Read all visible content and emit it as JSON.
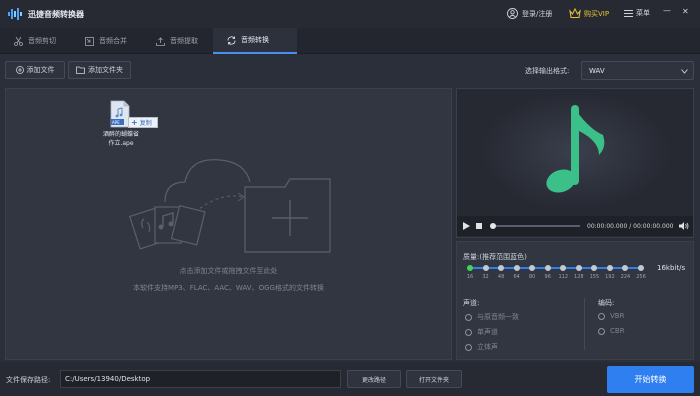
{
  "titlebar": {
    "app_title": "迅捷音频转换器",
    "login": "登录/注册",
    "vip": "购买VIP",
    "menu": "菜单",
    "minimize": "—",
    "close": "✕"
  },
  "tabs": [
    {
      "label": "音频剪切",
      "icon": "scissors-icon"
    },
    {
      "label": "音频合并",
      "icon": "merge-icon"
    },
    {
      "label": "音频提取",
      "icon": "upload-icon"
    },
    {
      "label": "音频转换",
      "icon": "refresh-icon"
    }
  ],
  "toolbar": {
    "add_file": "添加文件",
    "add_folder": "添加文件夹",
    "format_label": "选择输出格式:",
    "format_value": "WAV"
  },
  "file": {
    "name_line1": "酒醉的蝴蝶省",
    "name_line2": "作立.ape",
    "ext": "APE",
    "tooltip": "复制"
  },
  "drop": {
    "hint": "点击添加文件或拖拽文件至此处",
    "support": "本软件支持MP3、FLAC、AAC、WAV、OGG格式的文件转换"
  },
  "player": {
    "time": "00:00:00.000 / 00:00:00.000"
  },
  "quality": {
    "label": "质量:",
    "note": "(推荐范围蓝色)",
    "ticks": [
      "16",
      "32",
      "48",
      "64",
      "80",
      "96",
      "112",
      "128",
      "155",
      "192",
      "224",
      "256"
    ],
    "value_text": "16kbit/s",
    "level": 0
  },
  "channel": {
    "label": "声道:",
    "options": [
      "与原音频一致",
      "单声道",
      "立体声"
    ]
  },
  "encoding": {
    "label": "编码:",
    "options": [
      "VBR",
      "CBR"
    ]
  },
  "bottom": {
    "path_label": "文件保存路径:",
    "path_value": "C:/Users/13940/Desktop",
    "change_path": "更改路径",
    "open_folder": "打开文件夹",
    "start": "开始转换"
  },
  "colors": {
    "accent": "#2f7ff0",
    "note_green": "#3bc08a",
    "vip_gold": "#e8c33a"
  }
}
